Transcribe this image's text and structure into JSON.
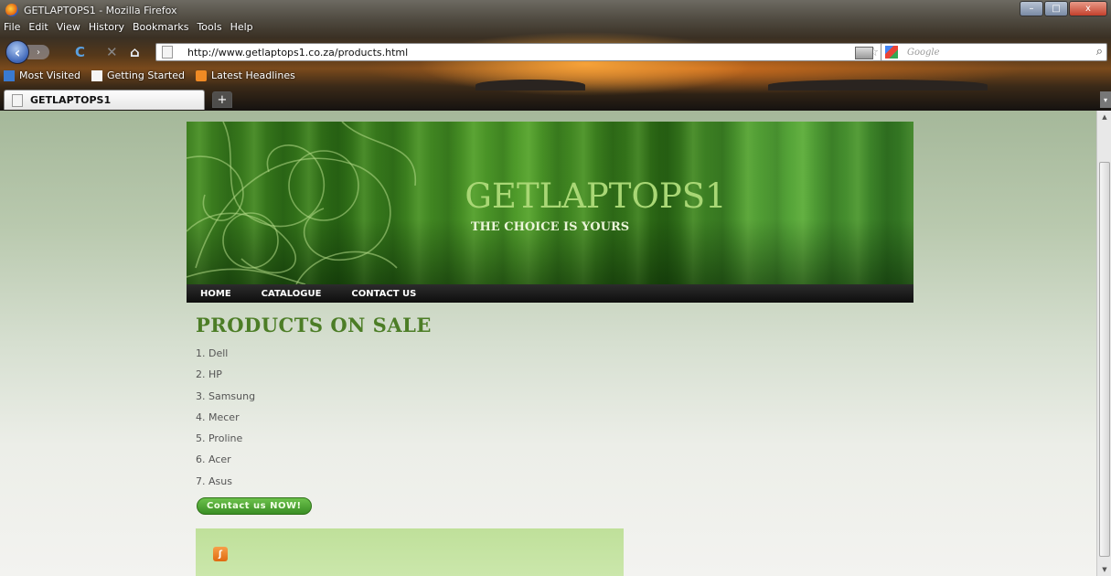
{
  "window": {
    "title": "GETLAPTOPS1 - Mozilla Firefox",
    "controls": {
      "minimize": "–",
      "maximize": "□",
      "close": "x"
    }
  },
  "menu": [
    "File",
    "Edit",
    "View",
    "History",
    "Bookmarks",
    "Tools",
    "Help"
  ],
  "nav": {
    "back_glyph": "‹",
    "forward_glyph": "›",
    "reload_glyph": "C",
    "stop_glyph": "✕",
    "home_glyph": "⌂",
    "url": "http://www.getlaptops1.co.za/products.html",
    "star_glyph": "☆",
    "search_placeholder": "Google",
    "search_glyph": "⌕"
  },
  "bookmarks": [
    "Most Visited",
    "Getting Started",
    "Latest Headlines"
  ],
  "tabs": {
    "active_label": "GETLAPTOPS1",
    "new_tab": "+",
    "list_glyph": "▾"
  },
  "site": {
    "title": "GETLAPTOPS1",
    "tagline": "THE CHOICE IS YOURS",
    "nav": [
      "HOME",
      "CATALOGUE",
      "CONTACT US"
    ],
    "heading": "PRODUCTS ON SALE",
    "products": [
      "1. Dell",
      "2. HP",
      "3. Samsung",
      "4. Mecer",
      "5. Proline",
      "6. Acer",
      "7. Asus"
    ],
    "contact_button": "Contact us NOW!",
    "rss_glyph": "ʃ"
  },
  "scrollbar": {
    "up": "▲",
    "down": "▼"
  },
  "colors": {
    "heading": "#4c7d26",
    "site_title": "#a9d775",
    "button": "#4aa12f",
    "footer_box": "#c6e4a4"
  }
}
